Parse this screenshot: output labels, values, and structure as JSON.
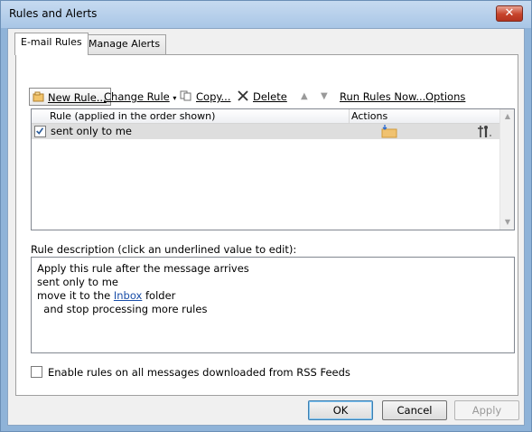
{
  "window": {
    "title": "Rules and Alerts",
    "close_glyph": "✕"
  },
  "tabs": [
    {
      "label": "E-mail Rules",
      "selected": true
    },
    {
      "label": "Manage Alerts",
      "selected": false
    }
  ],
  "toolbar": {
    "new_rule": "New Rule...",
    "change_rule": "Change Rule",
    "copy": "Copy...",
    "delete": "Delete",
    "run_rules_now": "Run Rules Now...",
    "options": "Options"
  },
  "rules_list": {
    "columns": [
      "Rule (applied in the order shown)",
      "Actions"
    ],
    "rows": [
      {
        "name": "sent only to me",
        "enabled": true,
        "action_icons": [
          "move-to-folder-icon",
          "stop-processing-icon"
        ]
      }
    ]
  },
  "description": {
    "label": "Rule description (click an underlined value to edit):",
    "lines": [
      "Apply this rule after the message arrives",
      "sent only to me",
      "move it to the",
      "Inbox",
      "folder",
      "  and stop processing more rules"
    ]
  },
  "rss_checkbox": {
    "label": "Enable rules on all messages downloaded from RSS Feeds",
    "checked": false
  },
  "buttons": {
    "ok": "OK",
    "cancel": "Cancel",
    "apply": "Apply"
  },
  "colors": {
    "link": "#1a4ea8",
    "accent": "#3c7fb1"
  }
}
